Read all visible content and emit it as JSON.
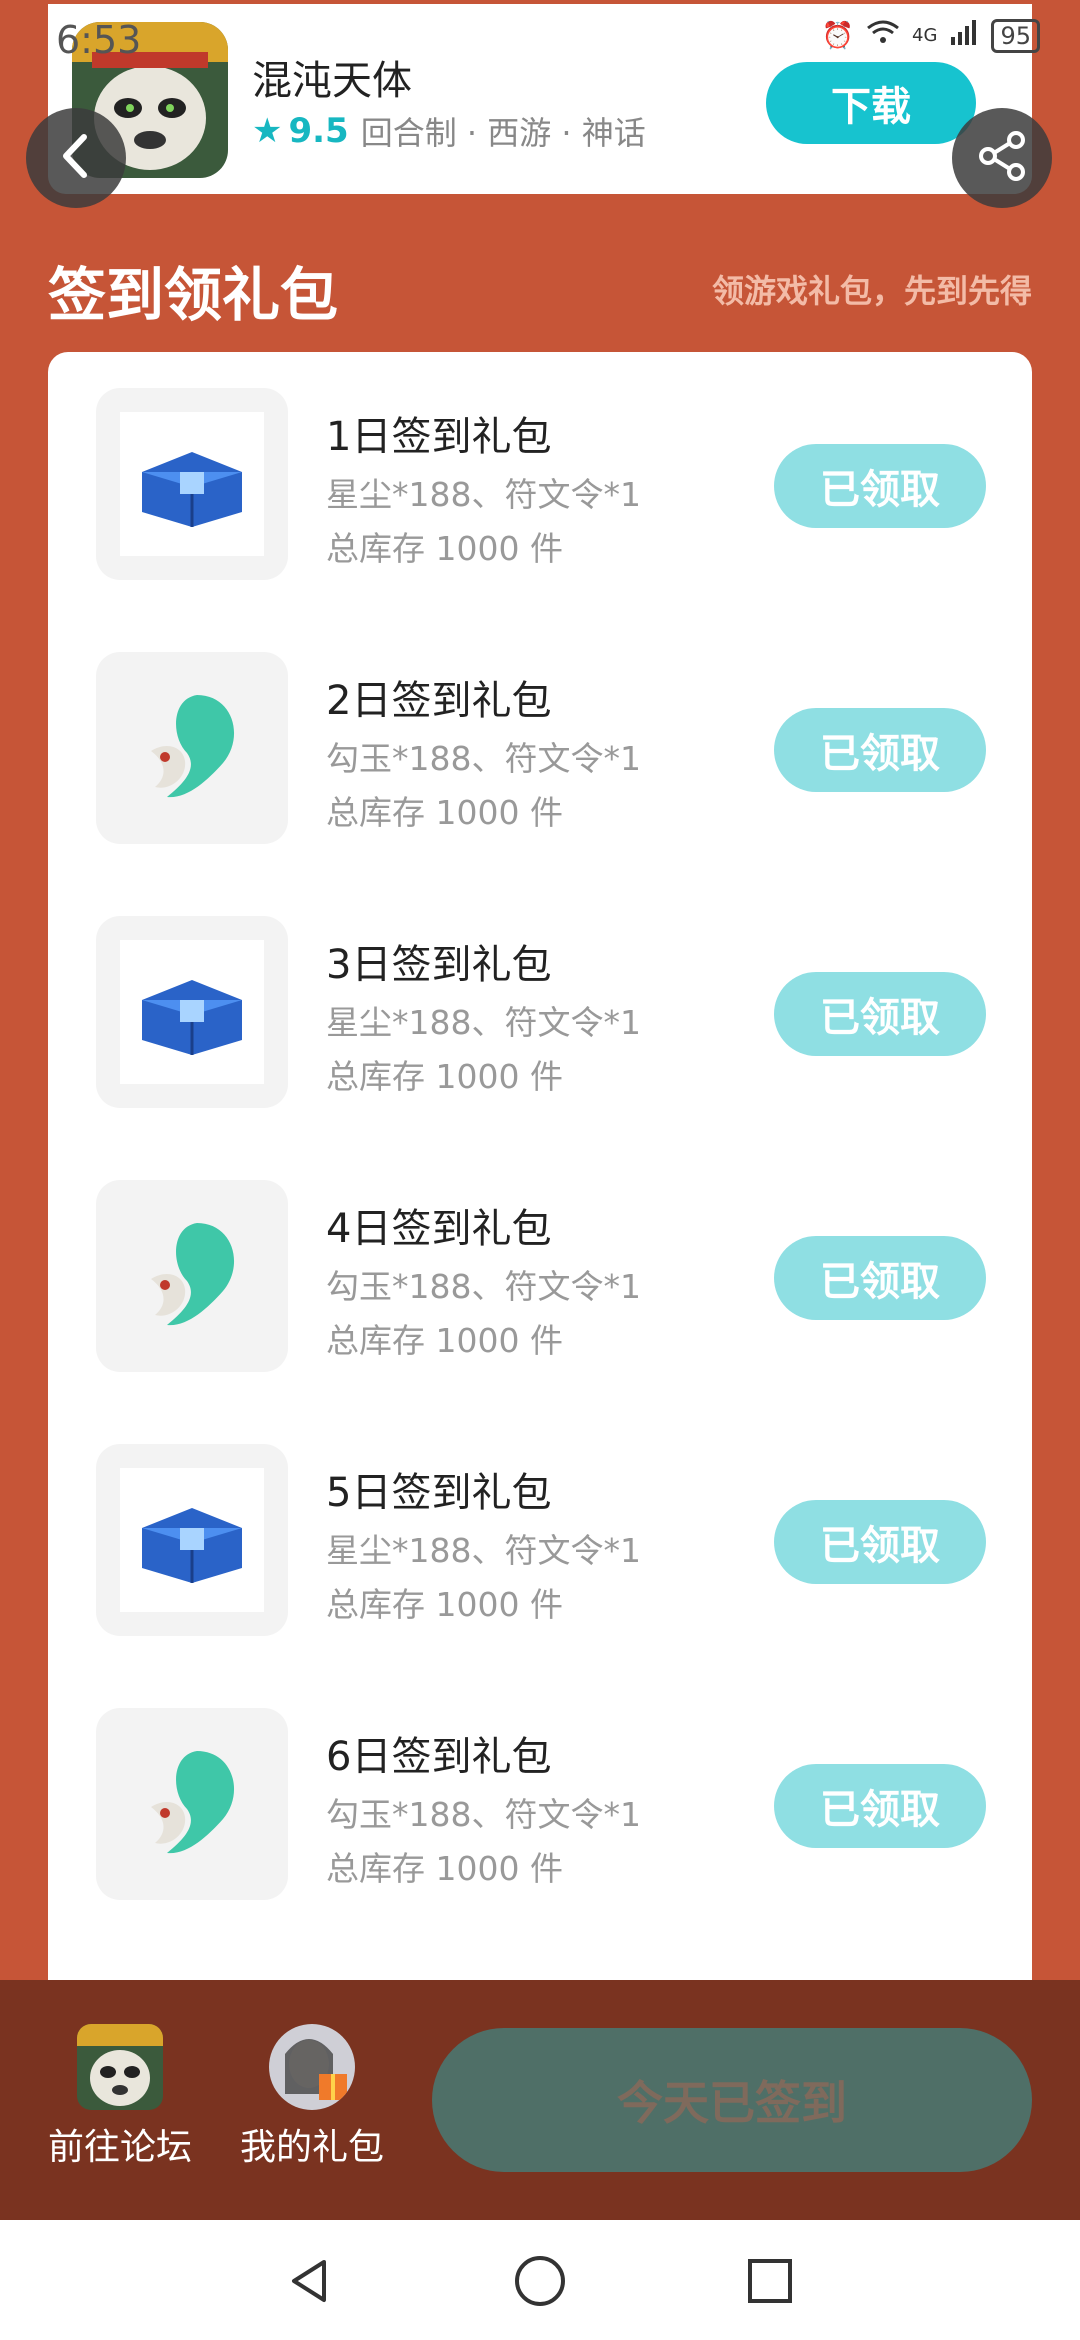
{
  "status_bar": {
    "time": "6:53",
    "network": "4G",
    "battery": "95"
  },
  "game": {
    "title": "混沌天体",
    "rating": "9.5",
    "tags": "回合制 · 西游 · 神话",
    "download_label": "下载"
  },
  "section": {
    "title": "签到领礼包",
    "subtitle": "领游戏礼包，先到先得"
  },
  "gifts": [
    {
      "name": "1日签到礼包",
      "items": "星尘*188、符文令*1",
      "stock": "总库存 1000 件",
      "status": "已领取",
      "icon": "blue-chest-icon"
    },
    {
      "name": "2日签到礼包",
      "items": "勾玉*188、符文令*1",
      "stock": "总库存 1000 件",
      "status": "已领取",
      "icon": "jade-magatama-icon"
    },
    {
      "name": "3日签到礼包",
      "items": "星尘*188、符文令*1",
      "stock": "总库存 1000 件",
      "status": "已领取",
      "icon": "blue-chest-icon"
    },
    {
      "name": "4日签到礼包",
      "items": "勾玉*188、符文令*1",
      "stock": "总库存 1000 件",
      "status": "已领取",
      "icon": "jade-magatama-icon"
    },
    {
      "name": "5日签到礼包",
      "items": "星尘*188、符文令*1",
      "stock": "总库存 1000 件",
      "status": "已领取",
      "icon": "blue-chest-icon"
    },
    {
      "name": "6日签到礼包",
      "items": "勾玉*188、符文令*1",
      "stock": "总库存 1000 件",
      "status": "已领取",
      "icon": "jade-magatama-icon"
    }
  ],
  "bottom": {
    "forum_label": "前往论坛",
    "my_gifts_label": "我的礼包",
    "checked_label": "今天已签到"
  },
  "colors": {
    "background": "#c65537",
    "accent": "#17c3cf",
    "claimed": "#8fdfe3",
    "bottom_bar": "#7a3320",
    "checked_btn": "#4f6f67"
  }
}
